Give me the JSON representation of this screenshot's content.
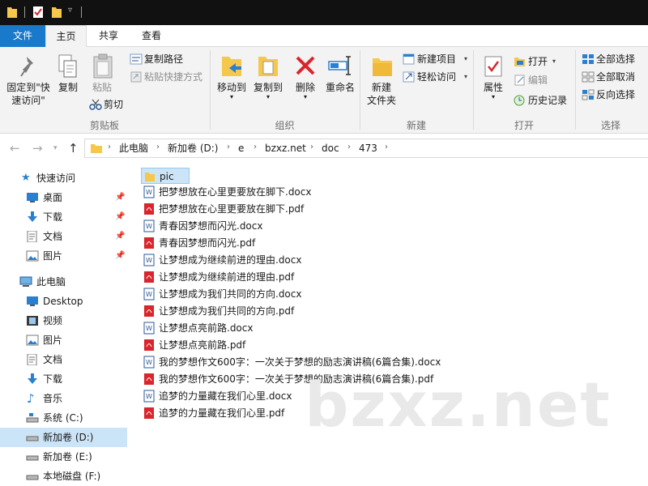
{
  "tabs": {
    "file": "文件",
    "home": "主页",
    "share": "共享",
    "view": "查看"
  },
  "ribbon": {
    "clipboard": {
      "label": "剪贴板",
      "pin_line1": "固定到\"快",
      "pin_line2": "速访问\"",
      "copy": "复制",
      "paste": "粘贴",
      "copy_path": "复制路径",
      "paste_shortcut": "粘贴快捷方式",
      "cut": "剪切"
    },
    "organize": {
      "label": "组织",
      "move_to": "移动到",
      "copy_to": "复制到",
      "delete": "删除",
      "rename": "重命名"
    },
    "new": {
      "label": "新建",
      "new_folder_line1": "新建",
      "new_folder_line2": "文件夹",
      "new_item": "新建项目",
      "easy_access": "轻松访问"
    },
    "open": {
      "label": "打开",
      "properties": "属性",
      "open": "打开",
      "edit": "编辑",
      "history": "历史记录"
    },
    "select": {
      "label": "选择",
      "select_all": "全部选择",
      "select_none": "全部取消",
      "invert": "反向选择"
    }
  },
  "address": {
    "crumbs": [
      "此电脑",
      "新加卷 (D:)",
      "e",
      "bzxz.net",
      "doc",
      "473"
    ]
  },
  "sidebar": {
    "quick_access": "快速访问",
    "qa_items": [
      "桌面",
      "下载",
      "文档",
      "图片"
    ],
    "this_pc": "此电脑",
    "pc_items": [
      "Desktop",
      "视频",
      "图片",
      "文档",
      "下载",
      "音乐",
      "系统 (C:)",
      "新加卷 (D:)",
      "新加卷 (E:)",
      "本地磁盘 (F:)"
    ]
  },
  "files": [
    {
      "name": "pic",
      "type": "folder"
    },
    {
      "name": "把梦想放在心里更要放在脚下.docx",
      "type": "docx"
    },
    {
      "name": "把梦想放在心里更要放在脚下.pdf",
      "type": "pdf"
    },
    {
      "name": "青春因梦想而闪光.docx",
      "type": "docx"
    },
    {
      "name": "青春因梦想而闪光.pdf",
      "type": "pdf"
    },
    {
      "name": "让梦想成为继续前进的理由.docx",
      "type": "docx"
    },
    {
      "name": "让梦想成为继续前进的理由.pdf",
      "type": "pdf"
    },
    {
      "name": "让梦想成为我们共同的方向.docx",
      "type": "docx"
    },
    {
      "name": "让梦想成为我们共同的方向.pdf",
      "type": "pdf"
    },
    {
      "name": "让梦想点亮前路.docx",
      "type": "docx"
    },
    {
      "name": "让梦想点亮前路.pdf",
      "type": "pdf"
    },
    {
      "name": "我的梦想作文600字：一次关于梦想的励志演讲稿(6篇合集).docx",
      "type": "docx"
    },
    {
      "name": "我的梦想作文600字：一次关于梦想的励志演讲稿(6篇合集).pdf",
      "type": "pdf"
    },
    {
      "name": "追梦的力量藏在我们心里.docx",
      "type": "docx"
    },
    {
      "name": "追梦的力量藏在我们心里.pdf",
      "type": "pdf"
    }
  ],
  "watermark": "bzxz.net",
  "colors": {
    "accent": "#1979ca",
    "selection": "#cce4f7",
    "folder": "#f5c74d",
    "word": "#2b5797",
    "pdf": "#d9252b"
  }
}
